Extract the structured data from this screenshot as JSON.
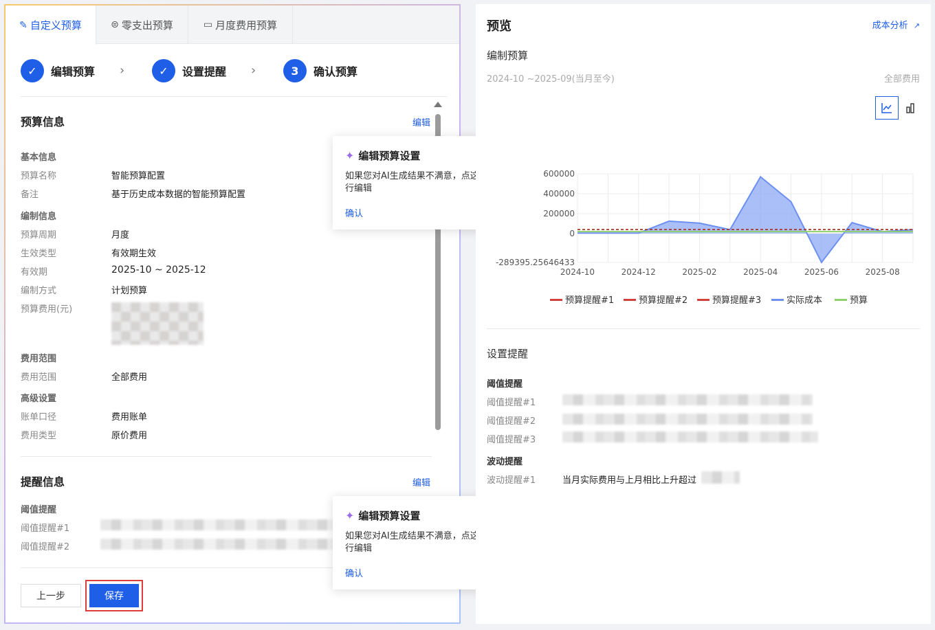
{
  "tabs": [
    {
      "label": "自定义预算",
      "icon": "pencil-icon"
    },
    {
      "label": "零支出预算",
      "icon": "yen-icon"
    },
    {
      "label": "月度费用预算",
      "icon": "calendar-icon"
    }
  ],
  "steps": [
    {
      "label": "编辑预算",
      "state": "done"
    },
    {
      "label": "设置提醒",
      "state": "done"
    },
    {
      "label": "确认预算",
      "state": "current",
      "number": "3"
    }
  ],
  "budget_info": {
    "title": "预算信息",
    "edit": "编辑",
    "basic": {
      "title": "基本信息",
      "name_key": "预算名称",
      "name_val": "智能预算配置",
      "note_key": "备注",
      "note_val": "基于历史成本数据的智能预算配置"
    },
    "compile": {
      "title": "编制信息",
      "period_key": "预算周期",
      "period_val": "月度",
      "effect_key": "生效类型",
      "effect_val": "有效期生效",
      "validity_key": "有效期",
      "validity_val": "2025-10 ~ 2025-12",
      "method_key": "编制方式",
      "method_val": "计划预算",
      "fee_key": "预算费用(元)"
    },
    "scope": {
      "title": "费用范围",
      "scope_key": "费用范围",
      "scope_val": "全部费用"
    },
    "advanced": {
      "title": "高级设置",
      "bill_key": "账单口径",
      "bill_val": "费用账单",
      "type_key": "费用类型",
      "type_val": "原价费用"
    }
  },
  "alert_info": {
    "title": "提醒信息",
    "edit": "编辑",
    "threshold_title": "阈值提醒",
    "t1_key": "阈值提醒#1",
    "t2_key": "阈值提醒#2"
  },
  "buttons": {
    "prev": "上一步",
    "save": "保存"
  },
  "popover": {
    "title": "编辑预算设置",
    "body": "如果您对AI生成结果不满意，点这里进行编辑",
    "confirm": "确认"
  },
  "preview": {
    "title": "预览",
    "link": "成本分析",
    "subtitle": "编制预算",
    "range": "2024-10 ~2025-09(当月至今)",
    "range_right": "全部费用",
    "alerts_title": "设置提醒",
    "threshold_title": "阈值提醒",
    "t1_key": "阈值提醒#1",
    "t2_key": "阈值提醒#2",
    "t3_key": "阈值提醒#3",
    "fluct_title": "波动提醒",
    "f1_key": "波动提醒#1",
    "f1_val": "当月实际费用与上月相比上升超过"
  },
  "colors": {
    "accent": "#1f5ee6",
    "alert_line": "#d23f3f",
    "actual": "#6b90f2",
    "budget": "#8fcf6e"
  },
  "chart_data": {
    "type": "area",
    "x": [
      "2024-10",
      "2024-11",
      "2024-12",
      "2025-01",
      "2025-02",
      "2025-03",
      "2025-04",
      "2025-05",
      "2025-06",
      "2025-07",
      "2025-08",
      "2025-09"
    ],
    "x_tick_labels": [
      "2024-10",
      "2024-12",
      "2025-02",
      "2025-04",
      "2025-06",
      "2025-08"
    ],
    "y_tick_labels": [
      "600000",
      "400000",
      "200000",
      "0",
      "-289395.25646433"
    ],
    "ylim": [
      -289395.25646433,
      600000
    ],
    "series": [
      {
        "name": "预算提醒#1",
        "type": "dashed-line",
        "values": [
          40000,
          40000,
          40000,
          40000,
          40000,
          40000,
          40000,
          40000,
          40000,
          40000,
          40000,
          40000
        ]
      },
      {
        "name": "预算提醒#2",
        "type": "dashed-line",
        "values": [
          40000,
          40000,
          40000,
          40000,
          40000,
          40000,
          40000,
          40000,
          40000,
          40000,
          40000,
          40000
        ]
      },
      {
        "name": "预算提醒#3",
        "type": "dashed-line",
        "values": [
          40000,
          40000,
          40000,
          40000,
          40000,
          40000,
          40000,
          40000,
          40000,
          40000,
          40000,
          40000
        ]
      },
      {
        "name": "实际成本",
        "type": "area",
        "values": [
          5000,
          5000,
          5000,
          125000,
          105000,
          40000,
          570000,
          320000,
          -289000,
          110000,
          20000,
          40000
        ]
      },
      {
        "name": "预算",
        "type": "line",
        "values": [
          20000,
          20000,
          20000,
          20000,
          20000,
          20000,
          20000,
          20000,
          20000,
          20000,
          20000,
          20000
        ]
      }
    ],
    "legend_position": "bottom",
    "grid": true
  }
}
